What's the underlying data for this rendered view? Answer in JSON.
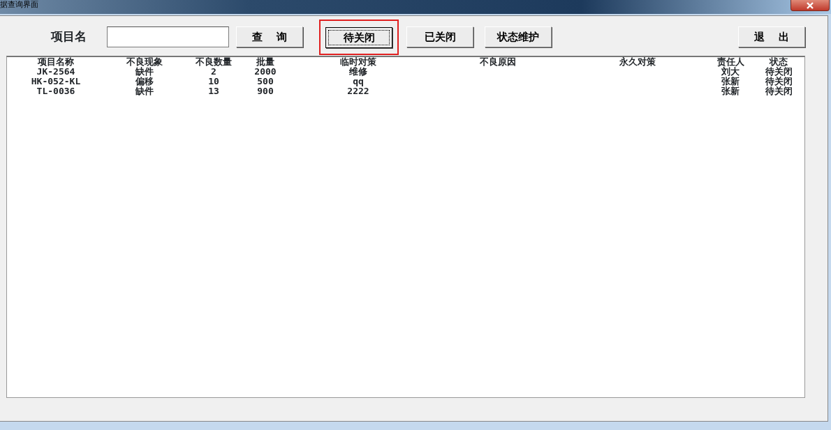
{
  "window": {
    "title": "据查询界面"
  },
  "toolbar": {
    "label": "项目名",
    "buttons": [
      {
        "label": "查 询",
        "kind": "action",
        "focused": false,
        "highlighted": false
      },
      {
        "label": "待关闭",
        "kind": "action",
        "focused": true,
        "highlighted": true
      },
      {
        "label": "已关闭",
        "kind": "action",
        "focused": false,
        "highlighted": false
      },
      {
        "label": "状态维护",
        "kind": "action",
        "focused": false,
        "highlighted": false
      },
      {
        "label": "退 出",
        "kind": "exit",
        "focused": false,
        "highlighted": false
      }
    ]
  },
  "table": {
    "columns": [
      "项目名称",
      "不良现象",
      "不良数量",
      "批量",
      "临时对策",
      "不良原因",
      "永久对策",
      "责任人",
      "状态"
    ],
    "rows": [
      {
        "project": "JK-2564",
        "defect": "缺件",
        "qty": "2",
        "batch": "2000",
        "temp_fix": "维修",
        "owner": "刘大",
        "status": "待关闭"
      },
      {
        "project": "HK-052-KL",
        "defect": "偏移",
        "qty": "10",
        "batch": "500",
        "temp_fix": "qq",
        "owner": "张新",
        "status": "待关闭"
      },
      {
        "project": "TL-0036",
        "defect": "缺件",
        "qty": "13",
        "batch": "900",
        "temp_fix": "2222",
        "owner": "张新",
        "status": "待关闭"
      }
    ]
  }
}
